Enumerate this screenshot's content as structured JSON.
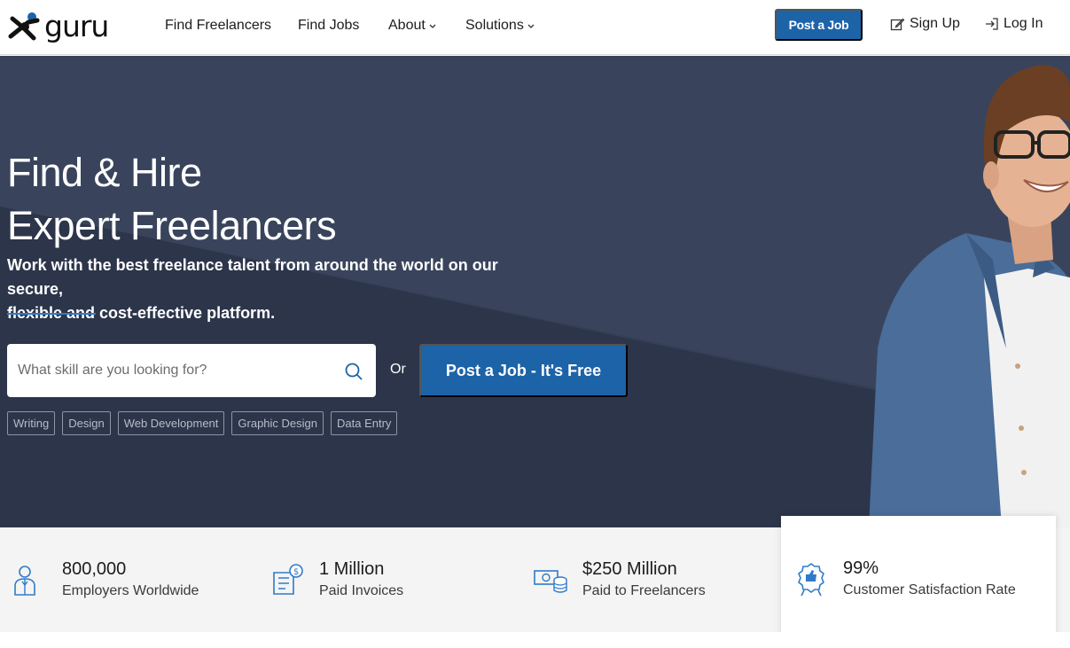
{
  "header": {
    "logo_text": "guru",
    "nav": [
      {
        "label": "Find Freelancers"
      },
      {
        "label": "Find Jobs"
      },
      {
        "label": "About",
        "dropdown": true
      },
      {
        "label": "Solutions",
        "dropdown": true
      }
    ],
    "post_job_label": "Post a Job",
    "sign_up_label": "Sign Up",
    "log_in_label": "Log In"
  },
  "hero": {
    "title_line1": "Find & Hire",
    "title_line2": "Expert Freelancers",
    "subtitle_line1": "Work with the best freelance talent from around the world on our secure,",
    "subtitle_line2": "flexible and cost-effective platform.",
    "search_placeholder": "What skill are you looking for?",
    "or_label": "Or",
    "cta_label": "Post a Job - It's Free",
    "tags": [
      "Writing",
      "Design",
      "Web Development",
      "Graphic Design",
      "Data Entry"
    ]
  },
  "stats": [
    {
      "value": "800,000",
      "label": "Employers Worldwide",
      "icon": "employer-icon"
    },
    {
      "value": "1 Million",
      "label": "Paid Invoices",
      "icon": "invoice-icon"
    },
    {
      "value": "$250 Million",
      "label": "Paid to Freelancers",
      "icon": "money-icon"
    },
    {
      "value": "99%",
      "label": "Customer Satisfaction Rate",
      "icon": "award-icon"
    }
  ],
  "colors": {
    "brand_blue": "#1d63a8",
    "hero_bg": "#353f55",
    "accent_rule": "#2f7bc9",
    "stats_bg": "#f4f4f4"
  }
}
